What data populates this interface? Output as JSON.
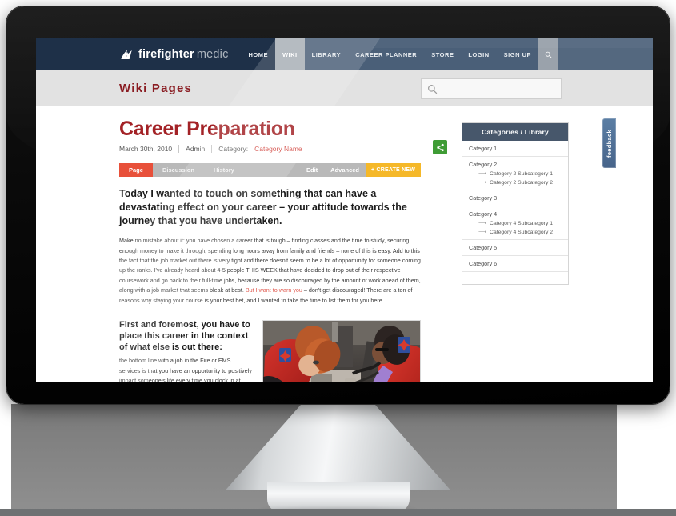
{
  "brand": {
    "name_bold": "firefighter",
    "name_light": "medic",
    "logo_icon": "flame-maltese-cross-icon"
  },
  "nav": {
    "items": [
      {
        "label": "HOME",
        "state": "default"
      },
      {
        "label": "WIKI",
        "state": "active"
      },
      {
        "label": "LIBRARY",
        "state": "default"
      },
      {
        "label": "CAREER PLANNER",
        "state": "default"
      },
      {
        "label": "STORE",
        "state": "default"
      },
      {
        "label": "LOGIN",
        "state": "default"
      },
      {
        "label": "SIGN UP",
        "state": "default"
      }
    ],
    "search_icon": "magnifier-icon"
  },
  "subheader": {
    "title": "Wiki Pages",
    "search": {
      "value": "",
      "placeholder": "",
      "icon": "magnifier-icon"
    }
  },
  "article": {
    "title": "Career Preparation",
    "meta": {
      "date": "March 30th, 2010",
      "author": "Admin",
      "category_label": "Category:",
      "category_name": "Category Name"
    },
    "share_icon": "share-nodes-icon",
    "tabs": [
      {
        "label": "Page",
        "state": "active"
      },
      {
        "label": "Discussion",
        "state": "default"
      },
      {
        "label": "History",
        "state": "default"
      }
    ],
    "actions": [
      {
        "label": "Edit"
      },
      {
        "label": "Advanced"
      }
    ],
    "create_button": "+ CREATE NEW",
    "lede": "Today I wanted to touch on something that can have a devastating effect on your career – your attitude towards the journey that you have undertaken.",
    "paragraph_1a": "Make no mistake about it: you have chosen a career that is tough – finding classes and the time to study, securing enough money to make it through, spending long hours away from family and friends – none of this is easy. Add to this the fact that the job market out there is very tight and there doesn't seem to be a lot of opportunity for someone coming up the ranks. I've already heard about 4-5 people THIS WEEK that have decided to drop out of their respective coursework and go back to their full-time jobs, because they are so discouraged by the amount of work ahead of them, along with a job market that seems bleak at best. ",
    "paragraph_1_warn": "But I want to warn you",
    "paragraph_1b": " – don't get discouraged! There are a ton of reasons why staying your course is your best bet, and I wanted to take the time to list them for you here....",
    "section_heading": "First and foremost, you have to place this career in the context of what else is out there:",
    "section_body": "the bottom line with a job in the Fire or EMS services is that you have an opportunity to positively impact someone's life every time you clock in at work. With most other jobs, you'll find yourself selling something to someone that doesn't need it, or logging long hours so that someone else above you can reap the rewards of your labor. In Fire or EMS, you reap the reward – which is knowing you are out there making a difference in this world.",
    "photo_alt": "two EMS responders in red uniforms treating a patient inside an ambulance"
  },
  "sidebar": {
    "heading": "Categories / Library",
    "items": [
      {
        "label": "Category 1",
        "subs": []
      },
      {
        "label": "Category 2",
        "subs": [
          "Category 2 Subcategory 1",
          "Category 2 Subcategory 2"
        ]
      },
      {
        "label": "Category 3",
        "subs": []
      },
      {
        "label": "Category 4",
        "subs": [
          "Category 4 Subcategory 1",
          "Category 4 Subcategory 2"
        ]
      },
      {
        "label": "Category 5",
        "subs": []
      },
      {
        "label": "Category 6",
        "subs": []
      }
    ]
  },
  "feedback": {
    "label": "feedback"
  },
  "colors": {
    "header_navy": "#1e3048",
    "nav_slate": "#4a5f78",
    "nav_active": "#a7aeb6",
    "subheader_gray": "#e2e2e2",
    "title_red": "#a32226",
    "accent_red": "#d2433c",
    "tab_active_red": "#e8503a",
    "tab_gray": "#b9b9b9",
    "create_orange": "#f5b829",
    "share_green": "#3f9c35",
    "sidebar_head": "#47576b",
    "feedback_blue": "#4f6e95"
  }
}
